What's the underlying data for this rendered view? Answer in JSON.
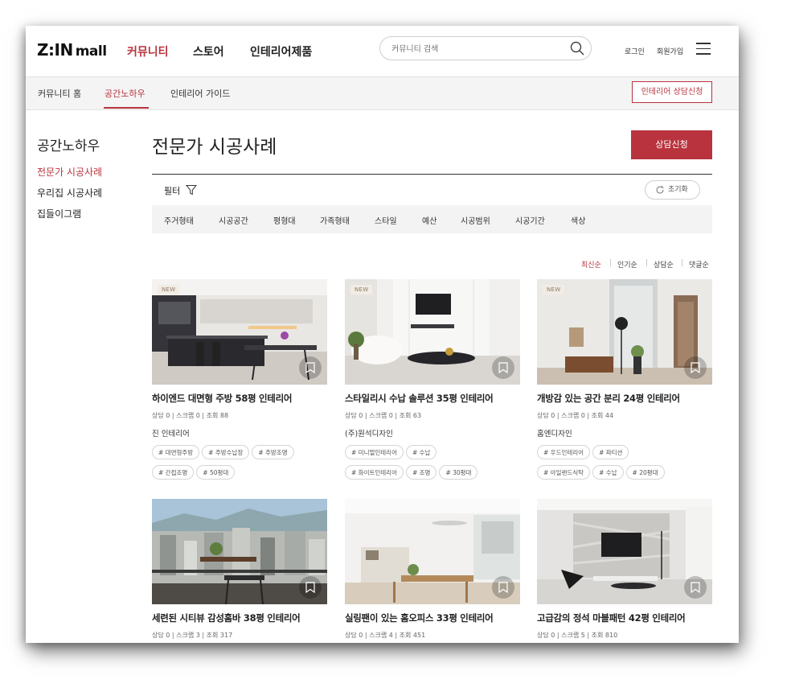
{
  "brand": {
    "logo_zin": "Z:IN",
    "logo_mall": "mall",
    "accent": "#b8333d"
  },
  "main_nav": [
    {
      "label": "커뮤니티",
      "active": true
    },
    {
      "label": "스토어",
      "active": false
    },
    {
      "label": "인테리어제품",
      "active": false
    }
  ],
  "search": {
    "placeholder": "커뮤니티 검색",
    "icon": "search-icon"
  },
  "account": {
    "login": "로그인",
    "signup": "회원가입",
    "menu_icon": "hamburger-icon"
  },
  "sub_nav": [
    {
      "label": "커뮤니티 홈",
      "active": false
    },
    {
      "label": "공간노하우",
      "active": true
    },
    {
      "label": "인테리어 가이드",
      "active": false
    }
  ],
  "sub_nav_button": "인테리어 상담신청",
  "sidebar": {
    "title": "공간노하우",
    "items": [
      {
        "label": "전문가 시공사례",
        "active": true
      },
      {
        "label": "우리집 시공사례",
        "active": false
      },
      {
        "label": "집들이그램",
        "active": false
      }
    ]
  },
  "page": {
    "title": "전문가 시공사례",
    "consult_button": "상담신청"
  },
  "filter": {
    "label": "필터",
    "reset": "초기화",
    "categories": [
      "주거형태",
      "시공공간",
      "평형대",
      "가족형태",
      "스타일",
      "예산",
      "시공범위",
      "시공기간",
      "색상"
    ]
  },
  "sort": [
    {
      "label": "최신순",
      "active": true
    },
    {
      "label": "인기순",
      "active": false
    },
    {
      "label": "상담순",
      "active": false
    },
    {
      "label": "댓글순",
      "active": false
    }
  ],
  "cards": [
    {
      "badge": "NEW",
      "title": "하이엔드 대면형 주방 58평 인테리어",
      "stats": "상담 0 | 스크랩 0 | 조회 88",
      "company": "진 인테리어",
      "tags_row1": [
        "# 대면형주방",
        "# 주방수납장",
        "# 주방조명"
      ],
      "tags_row2": [
        "# 간접조명",
        "# 50평대"
      ]
    },
    {
      "badge": "NEW",
      "title": "스타일리시 수납 솔루션 35평 인테리어",
      "stats": "상담 0 | 스크랩 0 | 조회 63",
      "company": "(주)원석디자인",
      "tags_row1": [
        "# 미니멀인테리어",
        "# 수납"
      ],
      "tags_row2": [
        "# 화이트인테리어",
        "# 조명",
        "# 30평대"
      ]
    },
    {
      "badge": "NEW",
      "title": "개방감 있는 공간 분리 24평 인테리어",
      "stats": "상담 0 | 스크랩 0 | 조회 44",
      "company": "홈엔디자인",
      "tags_row1": [
        "# 우드인테리어",
        "# 파티션"
      ],
      "tags_row2": [
        "# 아일랜드식탁",
        "# 수납",
        "# 20평대"
      ]
    },
    {
      "badge": "",
      "title": "세련된 시티뷰 감성홈바 38평 인테리어",
      "stats": "상담 0 | 스크랩 3 | 조회 317",
      "company": "",
      "tags_row1": [],
      "tags_row2": []
    },
    {
      "badge": "",
      "title": "실링팬이 있는 홈오피스 33평 인테리어",
      "stats": "상담 0 | 스크랩 4 | 조회 451",
      "company": "",
      "tags_row1": [],
      "tags_row2": []
    },
    {
      "badge": "",
      "title": "고급감의 정석 마블패턴 42평 인테리어",
      "stats": "상담 0 | 스크랩 5 | 조회 810",
      "company": "",
      "tags_row1": [],
      "tags_row2": []
    }
  ]
}
